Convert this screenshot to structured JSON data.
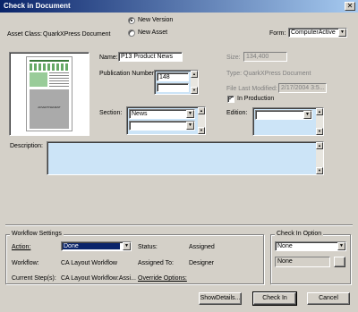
{
  "window": {
    "title": "Check in Document",
    "close_glyph": "✕"
  },
  "asset_class": {
    "label": "Asset Class:",
    "value": "QuarkXPress Document"
  },
  "version_options": {
    "new_version": "New Version",
    "new_asset": "New Asset",
    "selected": "new_version"
  },
  "form": {
    "label": "Form:",
    "value": "ComputerActive"
  },
  "preview": {
    "page_text": "ADVERTISEMENT"
  },
  "fields": {
    "name_label": "Name:",
    "name_value": "P13 Product News",
    "publication_number_label": "Publication Number:",
    "publication_number_values": [
      "148",
      ""
    ],
    "section_label": "Section:",
    "section_values": [
      "News",
      ""
    ],
    "size_label": "Size:",
    "size_value": "134,400",
    "type_label": "Type:",
    "type_value": "QuarkXPress Document",
    "file_last_modified_label": "File Last Modified:",
    "file_last_modified_value": "2/17/2004 3:5...",
    "in_production_label": "In Production",
    "in_production_checked": true,
    "check_glyph": "✓",
    "edition_label": "Edition:",
    "edition_value": "",
    "description_label": "Description:",
    "description_value": ""
  },
  "workflow": {
    "group_label": "Workflow Settings",
    "action_label": "Action:",
    "action_value": "Done",
    "status_label": "Status:",
    "status_value": "Assigned",
    "workflow_label": "Workflow:",
    "workflow_value": "CA Layout Workflow",
    "assigned_to_label": "Assigned To:",
    "assigned_to_value": "Designer",
    "current_step_label": "Current Step(s):",
    "current_step_value": "CA Layout Workflow:Assi...",
    "override_options_label": "Override Options:"
  },
  "check_in_option": {
    "group_label": "Check In Option",
    "select_value": "None",
    "field_value": "None"
  },
  "buttons": {
    "show_details": "ShowDetails...",
    "check_in": "Check In",
    "cancel": "Cancel"
  },
  "glyphs": {
    "down": "▼",
    "up": "▲"
  },
  "colors": {
    "title_start": "#0a246a",
    "title_end": "#a6caf0",
    "selection": "#0a246a",
    "field_blue": "#cce4f7",
    "dialog_bg": "#d4d0c8"
  }
}
